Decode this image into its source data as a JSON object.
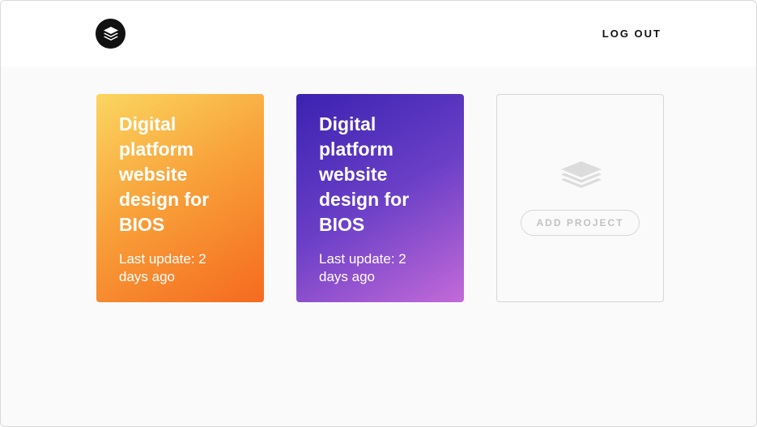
{
  "header": {
    "logo_icon": "layers-icon",
    "logout_label": "LOG OUT"
  },
  "projects": [
    {
      "title": "Digital platform website design for BIOS",
      "last_update": "Last update: 2 days ago",
      "gradient": [
        "#fbd660",
        "#f56a1f"
      ]
    },
    {
      "title": "Digital platform website design for BIOS",
      "last_update": "Last update: 2 days ago",
      "gradient": [
        "#3a22b0",
        "#c36ad8"
      ]
    }
  ],
  "add_project": {
    "icon": "layers-icon",
    "label": "ADD PROJECT"
  },
  "colors": {
    "background": "#fafafa",
    "header": "#ffffff",
    "text_dark": "#111111",
    "muted": "#c2c2c2"
  }
}
